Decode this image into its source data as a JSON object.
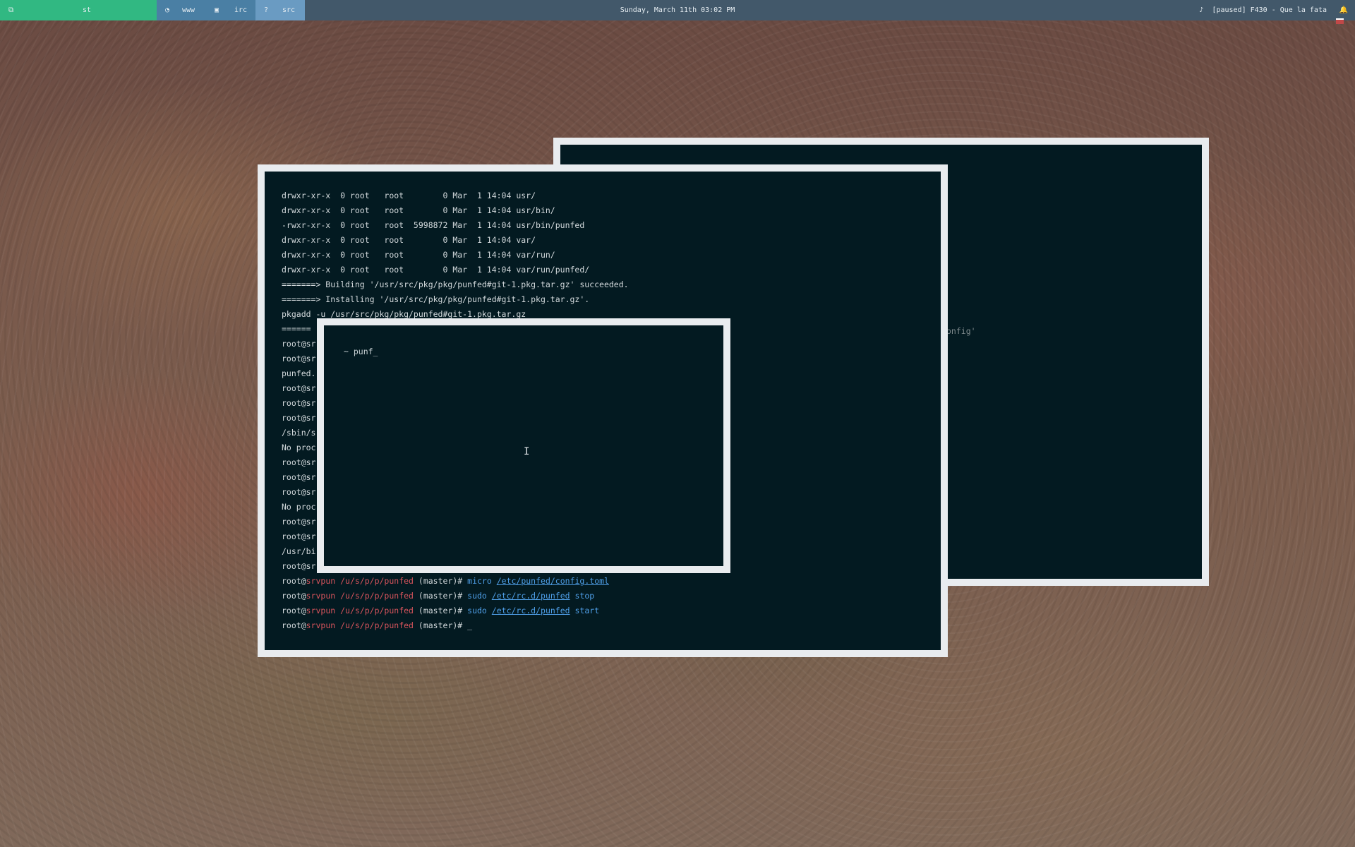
{
  "topbar": {
    "workspaces": [
      {
        "icon": "⧉",
        "label": "st"
      },
      {
        "icon": "◔",
        "label": "www"
      },
      {
        "icon": "▣",
        "label": "irc"
      },
      {
        "icon": "?",
        "label": "src"
      }
    ],
    "clock": "Sunday, March 11th 03:02 PM",
    "music_icon": "♪",
    "music": "[paused] F430 - Que la fata",
    "bell_icon": "🔔"
  },
  "back_terminal": {
    "fragment": "onfig'"
  },
  "main_terminal": {
    "plain_lines": [
      "drwxr-xr-x  0 root   root        0 Mar  1 14:04 usr/",
      "drwxr-xr-x  0 root   root        0 Mar  1 14:04 usr/bin/",
      "-rwxr-xr-x  0 root   root  5998872 Mar  1 14:04 usr/bin/punfed",
      "drwxr-xr-x  0 root   root        0 Mar  1 14:04 var/",
      "drwxr-xr-x  0 root   root        0 Mar  1 14:04 var/run/",
      "drwxr-xr-x  0 root   root        0 Mar  1 14:04 var/run/punfed/",
      "=======> Building '/usr/src/pkg/pkg/punfed#git-1.pkg.tar.gz' succeeded.",
      "=======> Installing '/usr/src/pkg/pkg/punfed#git-1.pkg.tar.gz'.",
      "pkgadd -u /usr/src/pkg/pkg/punfed#git-1.pkg.tar.gz",
      "======",
      "root@sr",
      "root@sr",
      "punfed.",
      "root@sr",
      "root@sr",
      "root@sr",
      "/sbin/s",
      "No proc",
      "root@sr",
      "root@sr",
      "root@sr",
      "No proc",
      "root@sr",
      "root@sr",
      "/usr/bi",
      "root@sr"
    ],
    "prompt": {
      "user": "root@",
      "host": "srvpun",
      "path": "/u/s/p/p/punfed",
      "branch": "(master)#"
    },
    "commands": [
      {
        "cmd": "micro",
        "arg": "/etc/punfed/config.toml",
        "tail": ""
      },
      {
        "cmd": "sudo",
        "arg": "/etc/rc.d/punfed",
        "tail": "stop"
      },
      {
        "cmd": "sudo",
        "arg": "/etc/rc.d/punfed",
        "tail": "start"
      }
    ],
    "cursor": "_"
  },
  "front_terminal": {
    "input": "~ punf_"
  }
}
